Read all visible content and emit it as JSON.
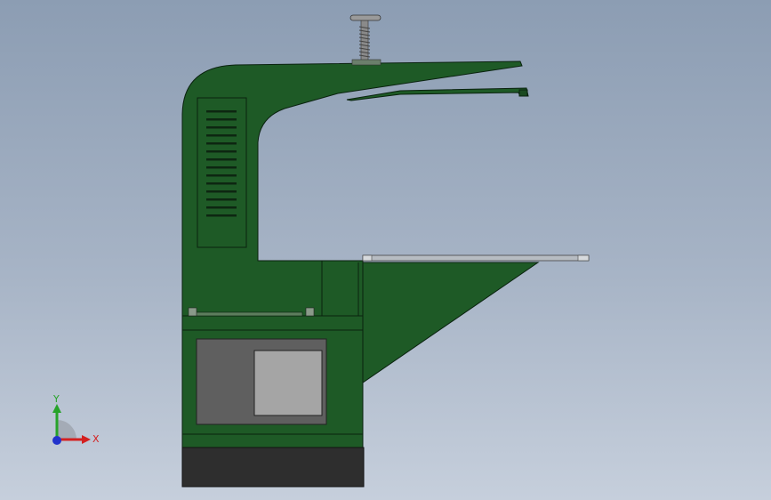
{
  "viewport": {
    "background_top": "#8c9db3",
    "background_bottom": "#c6cfdc"
  },
  "model": {
    "body_color": "#1e5a26",
    "edge_color": "#0a220f",
    "panel_color": "#5f5f5f",
    "window_color": "#a5a5a5",
    "base_color": "#2e2e2e",
    "table_color": "#b7bcc2",
    "screw_color": "#8a8a8a"
  },
  "triad": {
    "x_label": "X",
    "y_label": "Y",
    "x_color": "#d42020",
    "y_color": "#27a32a",
    "z_color": "#2233cc"
  }
}
